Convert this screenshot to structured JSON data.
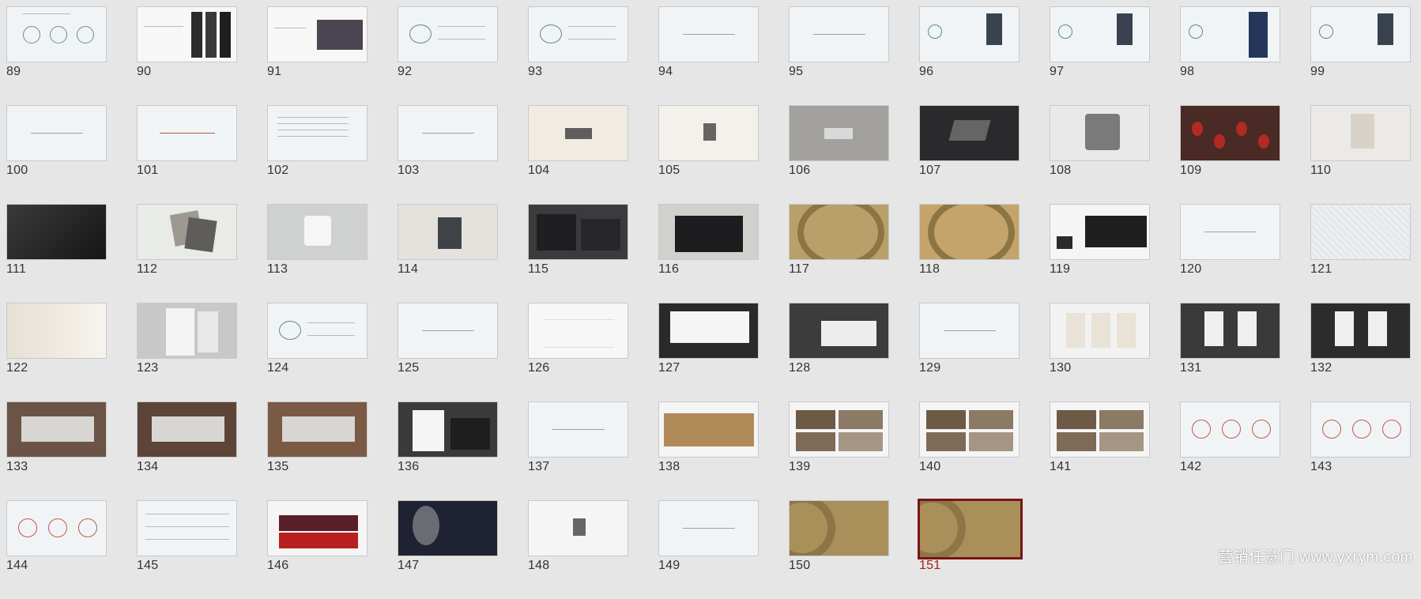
{
  "slides": [
    {
      "n": "89",
      "bg": "#f1f4f6",
      "kind": "circles"
    },
    {
      "n": "90",
      "bg": "#f7f7f7",
      "kind": "people"
    },
    {
      "n": "91",
      "bg": "#f7f7f7",
      "kind": "photo-right",
      "accent": "#4a4550"
    },
    {
      "n": "92",
      "bg": "#f1f4f6",
      "kind": "leaf-diagram"
    },
    {
      "n": "93",
      "bg": "#f1f4f6",
      "kind": "leaf-diagram"
    },
    {
      "n": "94",
      "bg": "#f1f4f6",
      "kind": "center-text"
    },
    {
      "n": "95",
      "bg": "#f1f4f6",
      "kind": "center-text"
    },
    {
      "n": "96",
      "bg": "#f1f4f6",
      "kind": "book"
    },
    {
      "n": "97",
      "bg": "#f1f4f6",
      "kind": "book"
    },
    {
      "n": "98",
      "bg": "#f1f4f6",
      "kind": "book-blue"
    },
    {
      "n": "99",
      "bg": "#f1f4f6",
      "kind": "book"
    },
    {
      "n": "100",
      "bg": "#f1f4f6",
      "kind": "center-text"
    },
    {
      "n": "101",
      "bg": "#f1f4f6",
      "kind": "center-text-red"
    },
    {
      "n": "102",
      "bg": "#f1f4f6",
      "kind": "text-lines"
    },
    {
      "n": "103",
      "bg": "#f1f4f6",
      "kind": "center-text"
    },
    {
      "n": "104",
      "bg": "#f0ece4",
      "kind": "logo-center"
    },
    {
      "n": "105",
      "bg": "#f4f1ec",
      "kind": "logo-small"
    },
    {
      "n": "106",
      "bg": "#a3a19e",
      "kind": "logo-grey"
    },
    {
      "n": "107",
      "bg": "#2a2a2c",
      "kind": "logo-dark"
    },
    {
      "n": "108",
      "bg": "#e9e9e9",
      "kind": "metal"
    },
    {
      "n": "109",
      "bg": "#4a2a24",
      "kind": "lanterns"
    },
    {
      "n": "110",
      "bg": "#eceae6",
      "kind": "card"
    },
    {
      "n": "111",
      "bg": "#2b2b2b",
      "kind": "dark-texture"
    },
    {
      "n": "112",
      "bg": "#e9ebe7",
      "kind": "cards"
    },
    {
      "n": "113",
      "bg": "#cfd1d0",
      "kind": "mug"
    },
    {
      "n": "114",
      "bg": "#e5e2de",
      "kind": "bag"
    },
    {
      "n": "115",
      "bg": "#3b3b3d",
      "kind": "boxes"
    },
    {
      "n": "116",
      "bg": "#d2d0cc",
      "kind": "watchbox"
    },
    {
      "n": "117",
      "bg": "#b7a06a",
      "kind": "gold-ring"
    },
    {
      "n": "118",
      "bg": "#c4a46a",
      "kind": "gold-ring"
    },
    {
      "n": "119",
      "bg": "#f5f5f5",
      "kind": "store-dark"
    },
    {
      "n": "120",
      "bg": "#f1f4f6",
      "kind": "center-text"
    },
    {
      "n": "121",
      "bg": "#e8ebee",
      "kind": "pattern"
    },
    {
      "n": "122",
      "bg": "#e6e0d4",
      "kind": "paper"
    },
    {
      "n": "123",
      "bg": "#c8c8c8",
      "kind": "calligraphy-cards"
    },
    {
      "n": "124",
      "bg": "#f1f4f6",
      "kind": "leaf-diagram"
    },
    {
      "n": "125",
      "bg": "#f1f4f6",
      "kind": "center-text"
    },
    {
      "n": "126",
      "bg": "#f7f7f7",
      "kind": "calligraphy"
    },
    {
      "n": "127",
      "bg": "#2a2a2a",
      "kind": "billboard"
    },
    {
      "n": "128",
      "bg": "#3c3c3c",
      "kind": "storefront"
    },
    {
      "n": "129",
      "bg": "#f1f4f6",
      "kind": "center-text"
    },
    {
      "n": "130",
      "bg": "#f2f2f2",
      "kind": "posters"
    },
    {
      "n": "131",
      "bg": "#3a3a3a",
      "kind": "posters-dark"
    },
    {
      "n": "132",
      "bg": "#2c2c2c",
      "kind": "posters-dark"
    },
    {
      "n": "133",
      "bg": "#6b5446",
      "kind": "showcase"
    },
    {
      "n": "134",
      "bg": "#5c4536",
      "kind": "showcase"
    },
    {
      "n": "135",
      "bg": "#7a5a44",
      "kind": "showcase"
    },
    {
      "n": "136",
      "bg": "#3a3a3a",
      "kind": "store-front"
    },
    {
      "n": "137",
      "bg": "#f1f4f6",
      "kind": "center-text"
    },
    {
      "n": "138",
      "bg": "#f5f5f5",
      "kind": "interior-warm"
    },
    {
      "n": "139",
      "bg": "#f5f5f5",
      "kind": "interior-grid"
    },
    {
      "n": "140",
      "bg": "#f5f5f5",
      "kind": "interior-grid"
    },
    {
      "n": "141",
      "bg": "#f5f5f5",
      "kind": "interior-grid"
    },
    {
      "n": "142",
      "bg": "#f1f4f6",
      "kind": "red-diagram"
    },
    {
      "n": "143",
      "bg": "#f1f4f6",
      "kind": "red-diagram"
    },
    {
      "n": "144",
      "bg": "#f1f4f6",
      "kind": "red-diagram"
    },
    {
      "n": "145",
      "bg": "#f1f4f6",
      "kind": "flow"
    },
    {
      "n": "146",
      "bg": "#f5f5f5",
      "kind": "collage"
    },
    {
      "n": "147",
      "bg": "#1f2233",
      "kind": "portrait"
    },
    {
      "n": "148",
      "bg": "#f5f5f5",
      "kind": "logo-small"
    },
    {
      "n": "149",
      "bg": "#f1f4f6",
      "kind": "center-text"
    },
    {
      "n": "150",
      "bg": "#a98f5a",
      "kind": "gold-end"
    },
    {
      "n": "151",
      "bg": "#a98f5a",
      "kind": "gold-end",
      "selected": true
    }
  ],
  "watermark": "营销任意门 www.yxrym.com",
  "colors": {
    "selected_border": "#7a1416",
    "selected_number": "#a41c1c",
    "number": "#333333",
    "workspace": "#e6e6e6"
  }
}
